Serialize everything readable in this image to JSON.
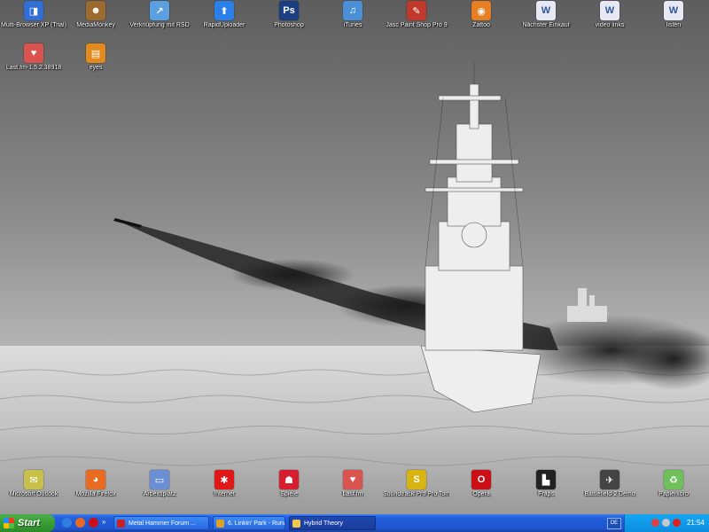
{
  "desktop": {
    "icons_top": [
      {
        "label": "Multi-Browser XP (Trial)",
        "icon": "multi-browser-icon",
        "color": "#2f6fd6",
        "glyph": "◨"
      },
      {
        "label": "MediaMonkey",
        "icon": "mediamonkey-icon",
        "color": "#9a6a2f",
        "glyph": "☻"
      },
      {
        "label": "Verknüpfung mit RSD",
        "icon": "rsd-shortcut-icon",
        "color": "#5aa0e0",
        "glyph": "↗"
      },
      {
        "label": "RapidUploader",
        "icon": "rapiduploader-icon",
        "color": "#2a7fe8",
        "glyph": "⬆"
      },
      {
        "label": "Photoshop",
        "icon": "photoshop-icon",
        "color": "#1b3f82",
        "glyph": "Ps"
      },
      {
        "label": "iTunes",
        "icon": "itunes-icon",
        "color": "#4a8fd8",
        "glyph": "♫"
      },
      {
        "label": "Jasc Paint Shop Pro 9",
        "icon": "paint-shop-pro-icon",
        "color": "#c0392b",
        "glyph": "✎"
      },
      {
        "label": "Zattoo",
        "icon": "zattoo-icon",
        "color": "#e67e22",
        "glyph": "◉"
      },
      {
        "label": "Nächster Einkauf",
        "icon": "word-document-icon",
        "color": "#e8e8f4",
        "glyph": "W"
      },
      {
        "label": "video links",
        "icon": "word-document-icon",
        "color": "#e8e8f4",
        "glyph": "W"
      },
      {
        "label": "listen",
        "icon": "word-document-icon",
        "color": "#e8e8f4",
        "glyph": "W"
      }
    ],
    "icons_second_row": [
      {
        "label": "Last.fm-1.5.2.38918",
        "icon": "lastfm-installer-icon",
        "color": "#d9534f",
        "glyph": "♥"
      },
      {
        "label": "eyes",
        "icon": "eyes-file-icon",
        "color": "#e38a1d",
        "glyph": "▤"
      }
    ],
    "icons_bottom": [
      {
        "label": "Microsoft Outlook",
        "icon": "outlook-icon",
        "color": "#c8c04a",
        "glyph": "✉"
      },
      {
        "label": "Mozilla Firefox",
        "icon": "firefox-icon",
        "color": "#e86b1f",
        "glyph": "◕"
      },
      {
        "label": "Arbeitsplatz",
        "icon": "my-computer-icon",
        "color": "#6a8fd4",
        "glyph": "▭"
      },
      {
        "label": "Internet",
        "icon": "internet-icon",
        "color": "#e01818",
        "glyph": "✱"
      },
      {
        "label": "Spiele",
        "icon": "games-icon",
        "color": "#d61e2e",
        "glyph": "☗"
      },
      {
        "label": "Last.fm",
        "icon": "lastfm-icon",
        "color": "#d9534f",
        "glyph": "♥"
      },
      {
        "label": "Soundtrack Pro Pro Tomorrow Super Pack",
        "icon": "soundtrack-icon",
        "color": "#d9b310",
        "glyph": "S"
      },
      {
        "label": "Opera",
        "icon": "opera-icon",
        "color": "#cc0f16",
        "glyph": "O"
      },
      {
        "label": "Fraps",
        "icon": "fraps-icon",
        "color": "#222222",
        "glyph": "▙"
      },
      {
        "label": "Battlefield 2 Demo",
        "icon": "battlefield-icon",
        "color": "#444444",
        "glyph": "✈"
      },
      {
        "label": "Papierkorb",
        "icon": "recycle-bin-icon",
        "color": "#6fbf5a",
        "glyph": "♻"
      }
    ]
  },
  "taskbar": {
    "start_label": "Start",
    "tasks": [
      {
        "label": "Metal Hammer Forum ...",
        "icon": "browser-icon",
        "color": "#cc2020",
        "active": false
      },
      {
        "label": "6. Linkin' Park - Runa...",
        "icon": "media-player-icon",
        "color": "#e0a020",
        "active": false
      },
      {
        "label": "Hybrid Theory",
        "icon": "folder-icon",
        "color": "#f2c94c",
        "active": true
      }
    ],
    "tray": {
      "language": "DE",
      "clock": "21:54"
    }
  }
}
